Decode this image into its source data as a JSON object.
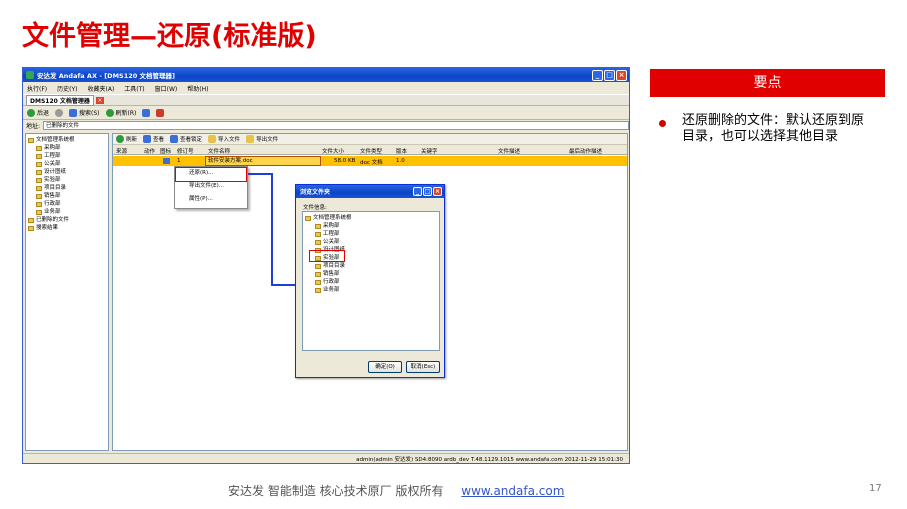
{
  "slide": {
    "title": "文件管理—还原(标准版)",
    "panel_heading": "要点",
    "bullet": "还原删除的文件：默认还原到原目录，也可以选择其他目录",
    "footer_text": "安达发   智能制造 核心技术原厂    版权所有",
    "footer_link": "www.andafa.com",
    "page_number": "17",
    "accent_color": "#e00000"
  },
  "app": {
    "window_title": "安达发 Andafa AX - [DMS120 文档管理器]",
    "menu": [
      "执行(F)",
      "历史(Y)",
      "收藏夹(A)",
      "工具(T)",
      "窗口(W)",
      "帮助(H)"
    ],
    "module_tab": "DMS120 文档管理器",
    "toolbar": [
      "后退",
      "搜索(S)",
      "刷新(R)"
    ],
    "address_label": "地址:",
    "address_value": "已删除的文件",
    "tree": {
      "root": "文档管理系统根",
      "children": [
        "采购部",
        "工程部",
        "公关部",
        "设计图纸",
        "实验部",
        "项目目录",
        "销售部",
        "行政部",
        "业务部"
      ],
      "deleted": "已删除的文件",
      "search": "搜索结果"
    },
    "list_toolbar": [
      "刷新",
      "查看",
      "查看锁定",
      "导入文件",
      "导出文件"
    ],
    "columns": [
      "来源",
      "动作",
      "图标",
      "修订号",
      "文件名称",
      "文件大小",
      "文件类型",
      "版本",
      "关键字",
      "文件描述",
      "最后动作描述"
    ],
    "row": {
      "revision": "1",
      "name": "软件安装方案.doc",
      "size": "58.0 KB",
      "type": "doc 文档",
      "version": "1.0"
    },
    "context_menu": [
      "还原(R)...",
      "导出文件(E)...",
      "属性(P)..."
    ],
    "status": "admin(admin 安达发)   SD4:8090   ardb_dev   T.48.1129.1015   www.andafa.com   2012-11-29 15:01:30"
  },
  "dialog": {
    "title": "浏览文件夹",
    "label": "文件信息:",
    "root": "文档管理系统根",
    "children": [
      "采购部",
      "工程部",
      "公关部",
      "设计图纸",
      "实验部",
      "项目目录",
      "销售部",
      "行政部",
      "业务部"
    ],
    "selected": "实验部",
    "ok": "确定(O)",
    "cancel": "取消(Esc)"
  }
}
